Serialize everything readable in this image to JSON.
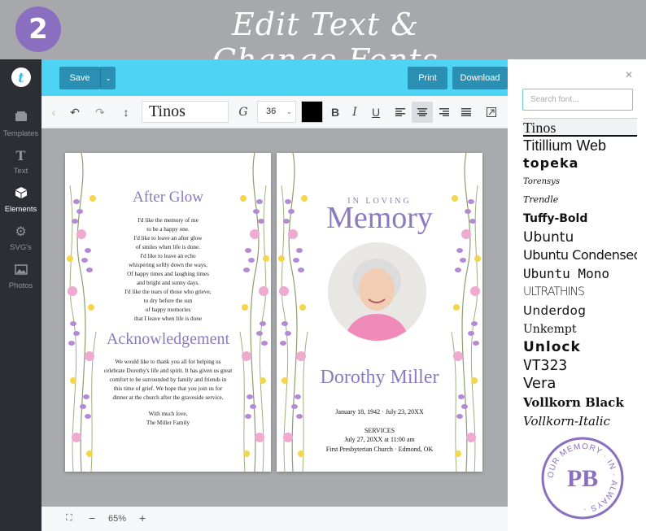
{
  "banner": {
    "step": "2",
    "title": "Edit Text & Change Fonts"
  },
  "sidebar": {
    "items": [
      {
        "label": "Templates",
        "icon": "templates-icon"
      },
      {
        "label": "Text",
        "icon": "text-icon"
      },
      {
        "label": "Elements",
        "icon": "elements-icon"
      },
      {
        "label": "SVG's",
        "icon": "gear-icon"
      },
      {
        "label": "Photos",
        "icon": "photos-icon"
      }
    ]
  },
  "topbar": {
    "save": "Save",
    "print": "Print",
    "download": "Download"
  },
  "toolbar": {
    "font": "Tinos",
    "size": "36",
    "color": "#000000"
  },
  "status": {
    "zoom": "65%"
  },
  "left_page": {
    "title": "After Glow",
    "poem": [
      "I'd like the memory of me",
      "to be a happy one.",
      "I'd like to leave an after glow",
      "of smiles when life is done.",
      "I'd like to leave an echo",
      "whispering softly down the ways,",
      "Of happy times and laughing times",
      "and bright and sunny days.",
      "I'd like the tears of those who grieve,",
      "to dry before the sun",
      "of happy memories",
      "that I leave when life is done"
    ],
    "ack_title": "Acknowledgement",
    "ack_text": [
      "We would like to thank you all for helping us",
      "celebrate Dorothy's life and spirit. It has given us great",
      "comfort to be surrounded by family and friends in",
      "this time of grief. We hope that you join us for",
      "dinner at the church after the graveside service."
    ],
    "signoff": [
      "With much love,",
      "The Miller Family"
    ]
  },
  "right_page": {
    "pre_title": "IN LOVING",
    "title": "Memory",
    "name": "Dorothy Miller",
    "dates": "January 18, 1942 · July 23, 20XX",
    "services_title": "SERVICES",
    "services_date": "July 27, 20XX at 11:00 am",
    "services_place": "First Presbyterian Church · Edmond, OK"
  },
  "font_panel": {
    "search_placeholder": "Search font...",
    "fonts": [
      "Tinos",
      "Titillium Web",
      "topeka",
      "Torensys",
      "Trendle",
      "Tuffy-Bold",
      "Ubuntu",
      "Ubuntu Condensed",
      "Ubuntu Mono",
      "ULTRATHINS",
      "Underdog",
      "Unkempt",
      "Unlock",
      "VT323",
      "Vera",
      "Vollkorn Black",
      "Vollkorn-Italic"
    ],
    "selected": "Tinos"
  },
  "seal": {
    "text": "OUR MEMORY IN ALWAYS",
    "monogram": "PB"
  },
  "colors": {
    "accent": "#4dd3f3",
    "button": "#2a8fb3",
    "purple": "#8a7bbf",
    "badge": "#8a6fc0"
  }
}
